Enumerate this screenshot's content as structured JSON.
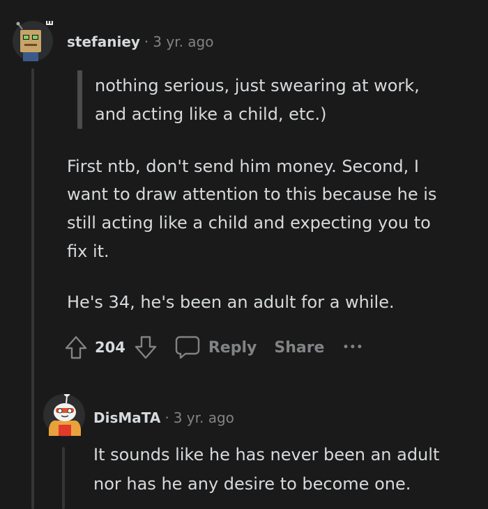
{
  "comment_1": {
    "username": "stefaniey",
    "time": "3 yr. ago",
    "quote_lines": [
      "nothing serious, just swearing at work,",
      "and acting like a child, etc.)"
    ],
    "paragraph_1_lines": [
      "First ntb, don't send him money. Second, I",
      "want to draw attention to this because he is",
      "still acting like a child and expecting you to",
      "fix it."
    ],
    "paragraph_2": "He's 34, he's been an adult for a while.",
    "vote_count": "204",
    "actions": {
      "reply": "Reply",
      "share": "Share",
      "more": "•••"
    }
  },
  "comment_2": {
    "username": "DisMaTA",
    "time": "3 yr. ago",
    "body_lines": [
      "It sounds like he has never been an adult",
      "nor has he any desire to become one."
    ]
  },
  "separator": "·",
  "colors": {
    "background": "#1a1a1b",
    "text": "#d7dadc",
    "meta": "#818384",
    "thread_line": "#343536",
    "quote_bar": "#4a4c4e"
  }
}
